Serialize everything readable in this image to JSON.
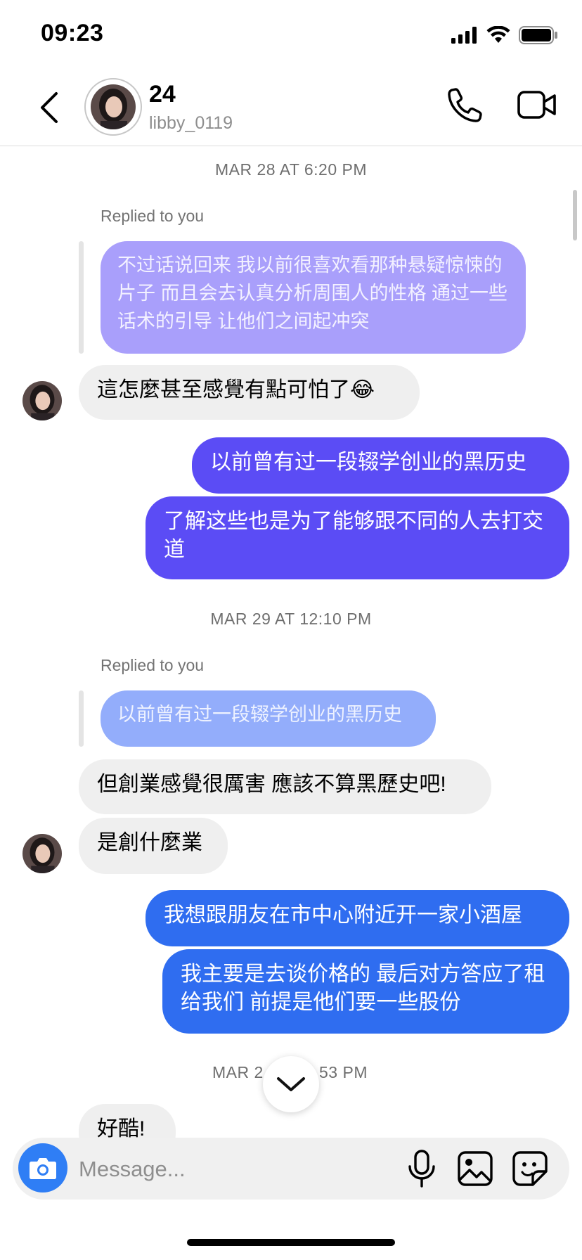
{
  "status_bar": {
    "time": "09:23"
  },
  "header": {
    "name": "24",
    "username": "libby_0119"
  },
  "timestamps": [
    "MAR 28 AT 6:20 PM",
    "MAR 29 AT 12:10 PM",
    "MAR 2",
    "53 PM"
  ],
  "reply_label": "Replied to you",
  "messages": {
    "reply1_quote": "不过话说回来 我以前很喜欢看那种悬疑惊悚的片子 而且会去认真分析周围人的性格 通过一些话术的引导 让他们之间起冲突",
    "m1": "這怎麼甚至感覺有點可怕了😂",
    "m2": "以前曾有过一段辍学创业的黑历史",
    "m3": "了解这些也是为了能够跟不同的人去打交道",
    "reply2_quote": "以前曾有过一段辍学创业的黑历史",
    "m4": "但創業感覺很厲害 應該不算黑歷史吧!",
    "m5": "是創什麼業",
    "m6": "我想跟朋友在市中心附近开一家小酒屋",
    "m7": "我主要是去谈价格的 最后对方答应了租给我们 前提是他们要一些股份",
    "m8": "好酷!"
  },
  "composer": {
    "placeholder": "Message..."
  },
  "colors": {
    "purple": "#5b4cf5",
    "blue": "#2f6df0",
    "gray_bubble": "#efefef"
  }
}
